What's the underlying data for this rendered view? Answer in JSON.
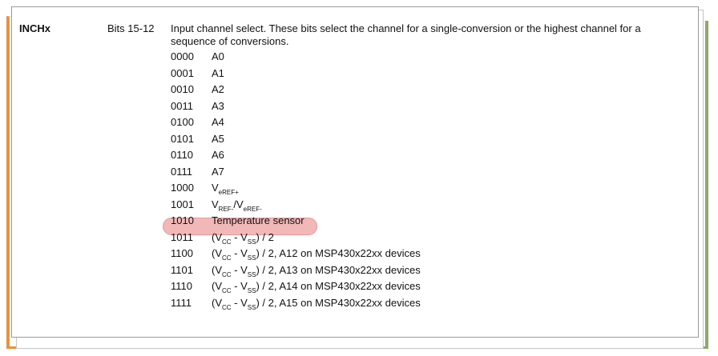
{
  "field": {
    "name": "INCHx",
    "bits": "Bits 15-12",
    "description": "Input channel select. These bits select the channel for a single-conversion or the highest channel for a sequence of conversions."
  },
  "rows": [
    {
      "code": "0000",
      "parts": [
        {
          "t": "A0"
        }
      ]
    },
    {
      "code": "0001",
      "parts": [
        {
          "t": "A1"
        }
      ]
    },
    {
      "code": "0010",
      "parts": [
        {
          "t": "A2"
        }
      ]
    },
    {
      "code": "0011",
      "parts": [
        {
          "t": "A3"
        }
      ]
    },
    {
      "code": "0100",
      "parts": [
        {
          "t": "A4"
        }
      ]
    },
    {
      "code": "0101",
      "parts": [
        {
          "t": "A5"
        }
      ]
    },
    {
      "code": "0110",
      "parts": [
        {
          "t": "A6"
        }
      ]
    },
    {
      "code": "0111",
      "parts": [
        {
          "t": "A7"
        }
      ]
    },
    {
      "code": "1000",
      "parts": [
        {
          "t": "V"
        },
        {
          "t": "eREF+",
          "sub": true
        }
      ]
    },
    {
      "code": "1001",
      "parts": [
        {
          "t": "V"
        },
        {
          "t": "REF-",
          "sub": true
        },
        {
          "t": "/V"
        },
        {
          "t": "eREF-",
          "sub": true
        }
      ]
    },
    {
      "code": "1010",
      "parts": [
        {
          "t": "Temperature sensor"
        }
      ],
      "highlighted": true
    },
    {
      "code": "1011",
      "parts": [
        {
          "t": "(V"
        },
        {
          "t": "CC",
          "sub": true
        },
        {
          "t": " - V"
        },
        {
          "t": "SS",
          "sub": true
        },
        {
          "t": ") / 2"
        }
      ]
    },
    {
      "code": "1100",
      "parts": [
        {
          "t": "(V"
        },
        {
          "t": "CC",
          "sub": true
        },
        {
          "t": " - V"
        },
        {
          "t": "SS",
          "sub": true
        },
        {
          "t": ") / 2, A12 on MSP430x22xx devices"
        }
      ]
    },
    {
      "code": "1101",
      "parts": [
        {
          "t": "(V"
        },
        {
          "t": "CC",
          "sub": true
        },
        {
          "t": " - V"
        },
        {
          "t": "SS",
          "sub": true
        },
        {
          "t": ") / 2, A13 on MSP430x22xx devices"
        }
      ]
    },
    {
      "code": "1110",
      "parts": [
        {
          "t": "(V"
        },
        {
          "t": "CC",
          "sub": true
        },
        {
          "t": " - V"
        },
        {
          "t": "SS",
          "sub": true
        },
        {
          "t": ") / 2, A14 on MSP430x22xx devices"
        }
      ]
    },
    {
      "code": "1111",
      "parts": [
        {
          "t": "(V"
        },
        {
          "t": "CC",
          "sub": true
        },
        {
          "t": " - V"
        },
        {
          "t": "SS",
          "sub": true
        },
        {
          "t": ") / 2, A15 on MSP430x22xx devices"
        }
      ]
    }
  ],
  "colors": {
    "highlight": "#f2b8b8",
    "frame_orange": "#e8923e",
    "frame_olive": "#8fa86a"
  }
}
